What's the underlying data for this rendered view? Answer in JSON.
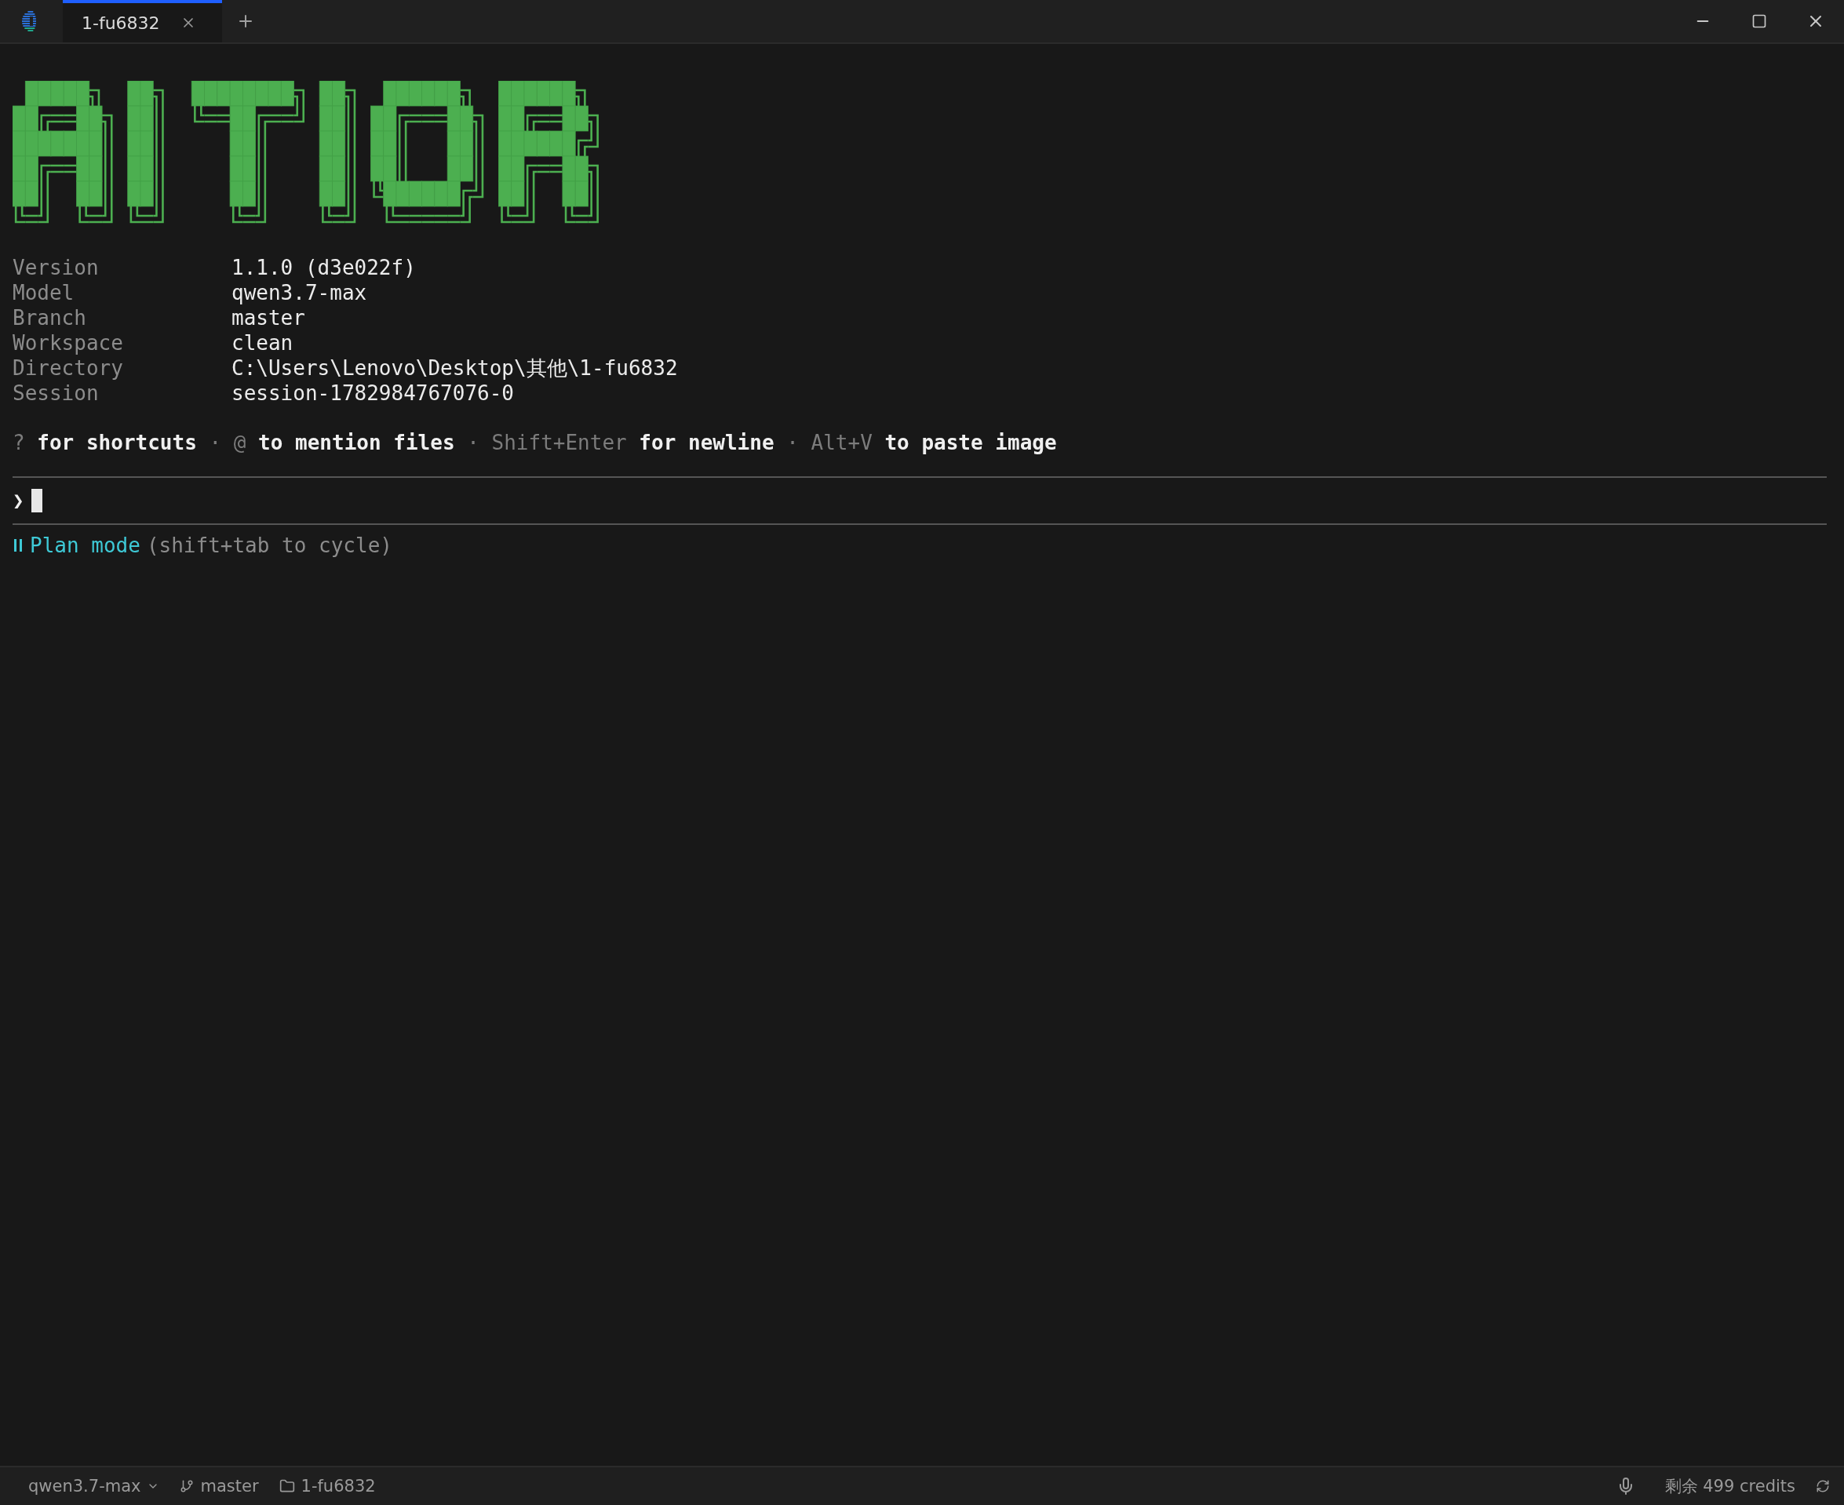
{
  "window": {
    "tabs": [
      {
        "label": "1-fu6832",
        "selected": true
      }
    ]
  },
  "info": [
    {
      "label": "Version",
      "value": "1.1.0 (d3e022f)"
    },
    {
      "label": "Model",
      "value": "qwen3.7-max"
    },
    {
      "label": "Branch",
      "value": "master"
    },
    {
      "label": "Workspace",
      "value": "clean"
    },
    {
      "label": "Directory",
      "value": "C:\\Users\\Lenovo\\Desktop\\其他\\1-fu6832"
    },
    {
      "label": "Session",
      "value": "session-1782984767076-0"
    }
  ],
  "hint": [
    {
      "text": "?",
      "dim": true
    },
    {
      "text": "for shortcuts",
      "dim": false
    },
    {
      "text": "·",
      "dim": true
    },
    {
      "text": "@",
      "dim": true
    },
    {
      "text": "to mention files",
      "dim": false
    },
    {
      "text": "·",
      "dim": true
    },
    {
      "text": "Shift+Enter",
      "dim": true
    },
    {
      "text": "for newline",
      "dim": false
    },
    {
      "text": "·",
      "dim": true
    },
    {
      "text": "Alt+V",
      "dim": true
    },
    {
      "text": "to paste image",
      "dim": false
    }
  ],
  "prompt": {
    "symbol": "❯"
  },
  "mode": {
    "name": "Plan mode",
    "hint": "(shift+tab to cycle)"
  },
  "status_bar": {
    "model": "qwen3.7-max",
    "branch": "master",
    "folder": "1-fu6832",
    "credits": "剩余 499 credits"
  }
}
